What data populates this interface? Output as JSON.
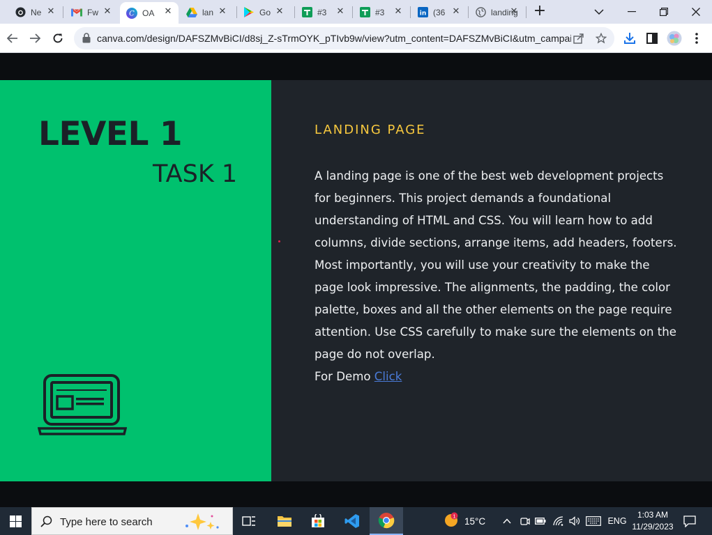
{
  "browser": {
    "tabs": [
      {
        "label": "Ne",
        "icon": "github-icon"
      },
      {
        "label": "Fw",
        "icon": "gmail-icon"
      },
      {
        "label": "OA",
        "icon": "canva-icon",
        "active": true
      },
      {
        "label": "lan",
        "icon": "google-drive-icon"
      },
      {
        "label": "Go",
        "icon": "google-play-icon"
      },
      {
        "label": "#3",
        "icon": "sheets-icon"
      },
      {
        "label": "#3",
        "icon": "sheets-icon"
      },
      {
        "label": "(36",
        "icon": "linkedin-icon"
      },
      {
        "label": "landing",
        "icon": "globe-icon"
      }
    ],
    "new_tab_label": "+",
    "url": "canva.com/design/DAFSZMvBiCI/d8sj_Z-sTrmOYK_pTIvb9w/view?utm_content=DAFSZMvBiCI&utm_campai..."
  },
  "slide": {
    "level_title": "LEVEL 1",
    "task_title": "TASK 1",
    "section_title": "LANDING PAGE",
    "body": "A landing page is one of the best web development projects for beginners. This project demands a foundational understanding of HTML and CSS. You will learn how to add columns, divide sections, arrange items, add headers, footers. Most importantly, you will use your creativity to make the page look impressive. The alignments, the padding, the color palette, boxes and all the other elements on the page require attention. Use CSS carefully to make sure the elements on the page do not overlap.",
    "demo_label": "For Demo",
    "demo_link": "Click ",
    "colors": {
      "green": "#00c16e",
      "dark": "#1f242a",
      "accent": "#f7c83e",
      "link": "#4a7bd8"
    }
  },
  "taskbar": {
    "search_placeholder": "Type here to search",
    "temperature": "15°C",
    "language": "ENG",
    "time": "1:03 AM",
    "date": "11/29/2023",
    "weather_badge": "1"
  }
}
